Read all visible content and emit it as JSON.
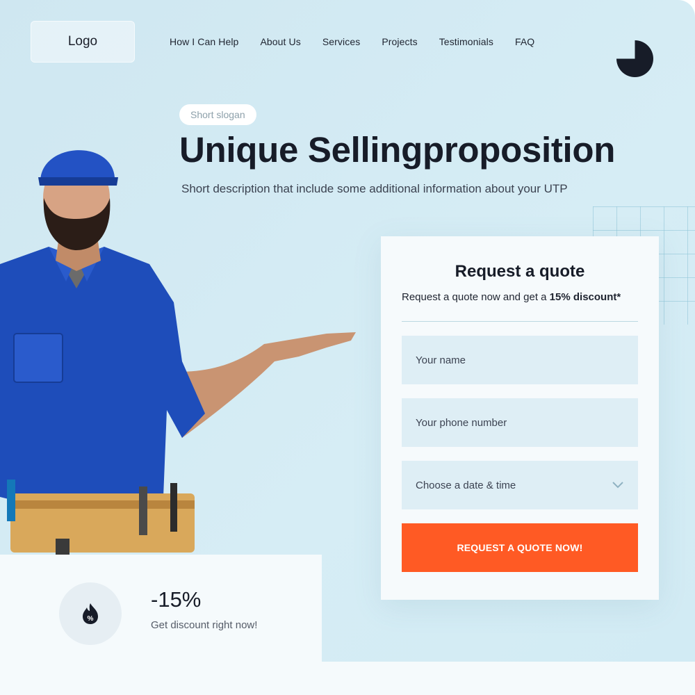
{
  "header": {
    "logo": "Logo",
    "nav": [
      "How I Can Help",
      "About Us",
      "Services",
      "Projects",
      "Testimonials",
      "FAQ"
    ]
  },
  "hero": {
    "slogan": "Short slogan",
    "headline": "Unique Sellingproposition",
    "description": "Short description that include some additional information about your UTP"
  },
  "form": {
    "title": "Request a quote",
    "subtitle_prefix": "Request a quote now and get a ",
    "subtitle_bold": "15% discount*",
    "name_placeholder": "Your name",
    "phone_placeholder": "Your phone number",
    "date_select": "Choose a date & time",
    "submit_label": "REQUEST A QUOTE NOW!"
  },
  "promo": {
    "value": "-15%",
    "text": "Get discount right now!"
  },
  "colors": {
    "accent": "#ff5a24",
    "dark": "#171c28",
    "hero_bg": "#d2ebf4"
  },
  "icons": {
    "pie": "pie-chart-icon",
    "discount": "discount-flame-icon",
    "chevron": "chevron-down-icon"
  }
}
